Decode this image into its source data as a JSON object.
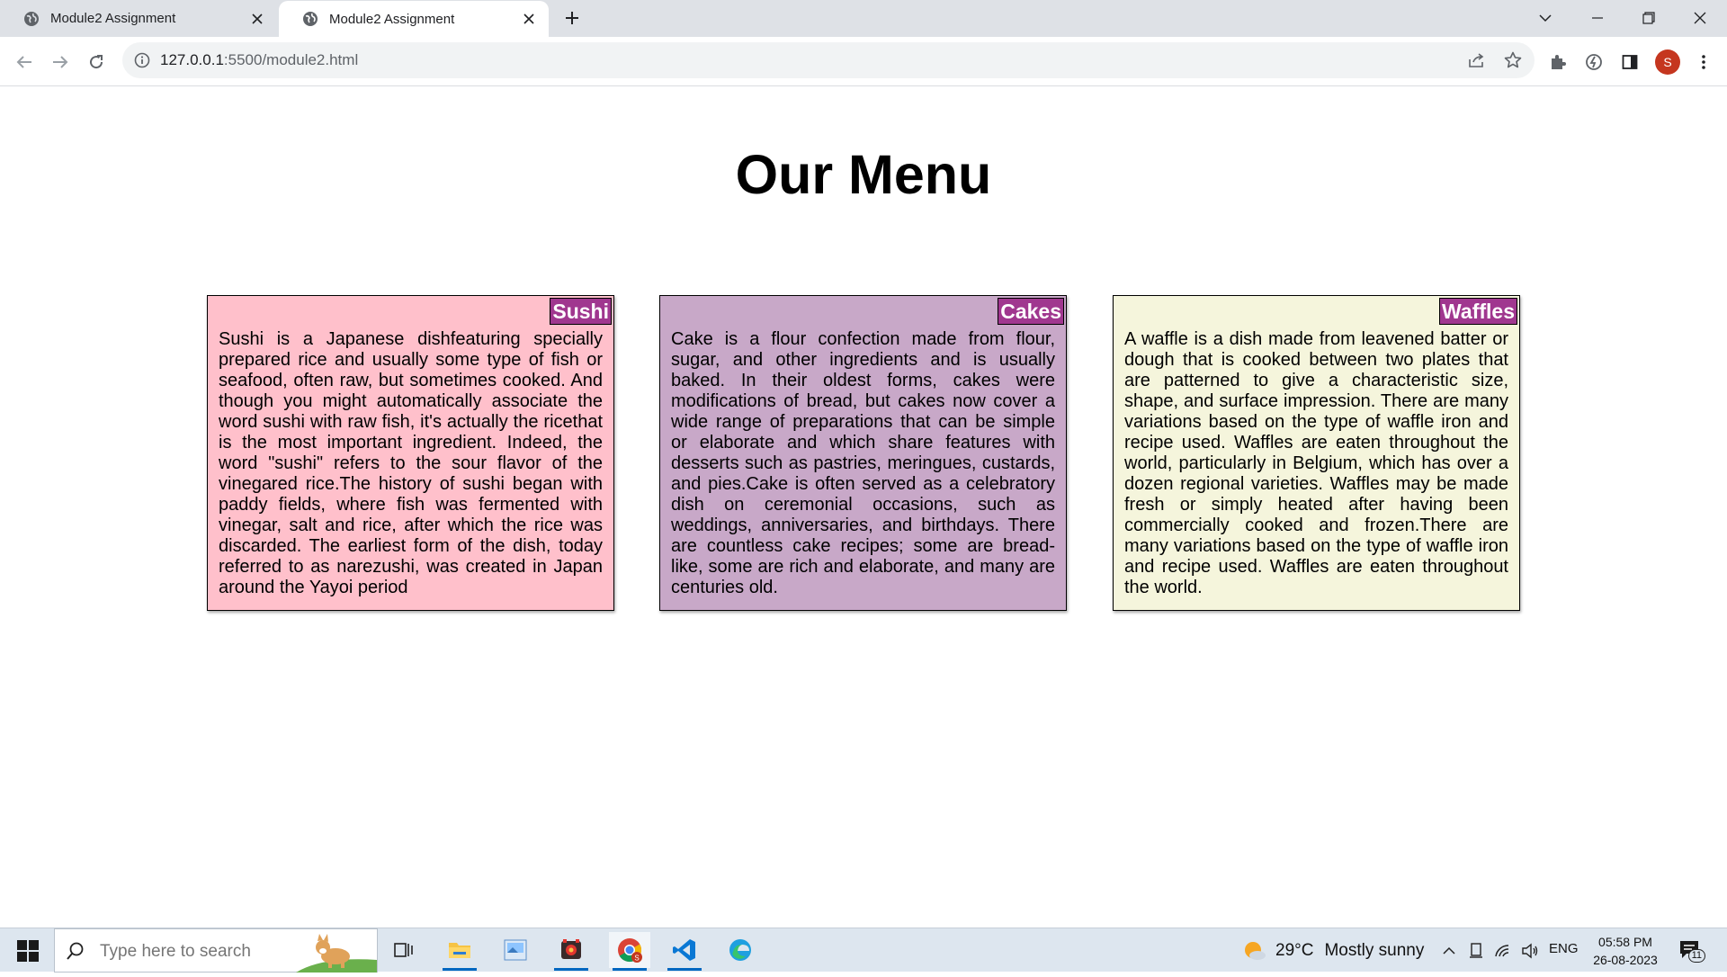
{
  "browser": {
    "tabs": [
      {
        "title": "Module2 Assignment",
        "active": false
      },
      {
        "title": "Module2 Assignment",
        "active": true
      }
    ],
    "url": {
      "host": "127.0.0.1",
      "rest": ":5500/module2.html"
    },
    "profile_initial": "S"
  },
  "page": {
    "heading": "Our Menu",
    "cards": [
      {
        "label": "Sushi",
        "background": "#ffc0cb",
        "text": "Sushi is a Japanese dishfeaturing specially prepared rice and usually some type of fish or seafood, often raw, but sometimes cooked. And though you might automatically associate the word sushi with raw fish, it's actually the ricethat is the most important ingredient. Indeed, the word \"sushi\" refers to the sour flavor of the vinegared rice.The history of sushi began with paddy fields, where fish was fermented with vinegar, salt and rice, after which the rice was discarded. The earliest form of the dish, today referred to as narezushi, was created in Japan around the Yayoi period"
      },
      {
        "label": "Cakes",
        "background": "#c8a8c8",
        "text": "Cake is a flour confection made from flour, sugar, and other ingredients and is usually baked. In their oldest forms, cakes were modifications of bread, but cakes now cover a wide range of preparations that can be simple or elaborate and which share features with desserts such as pastries, meringues, custards, and pies.Cake is often served as a celebratory dish on ceremonial occasions, such as weddings, anniversaries, and birthdays. There are countless cake recipes; some are bread-like, some are rich and elaborate, and many are centuries old."
      },
      {
        "label": "Waffles",
        "background": "#f5f5dc",
        "text": "A waffle is a dish made from leavened batter or dough that is cooked between two plates that are patterned to give a characteristic size, shape, and surface impression. There are many variations based on the type of waffle iron and recipe used. Waffles are eaten throughout the world, particularly in Belgium, which has over a dozen regional varieties. Waffles may be made fresh or simply heated after having been commercially cooked and frozen.There are many variations based on the type of waffle iron and recipe used. Waffles are eaten throughout the world."
      }
    ],
    "label_color": "#a0378f"
  },
  "taskbar": {
    "search_placeholder": "Type here to search",
    "weather": {
      "temp": "29°C",
      "condition": "Mostly sunny"
    },
    "language": "ENG",
    "time": "05:58 PM",
    "date": "26-08-2023",
    "notification_count": "11",
    "apps": [
      "task-view-icon",
      "file-explorer-icon",
      "photos-icon",
      "media-app-icon",
      "chrome-icon",
      "vscode-icon",
      "edge-icon"
    ]
  }
}
